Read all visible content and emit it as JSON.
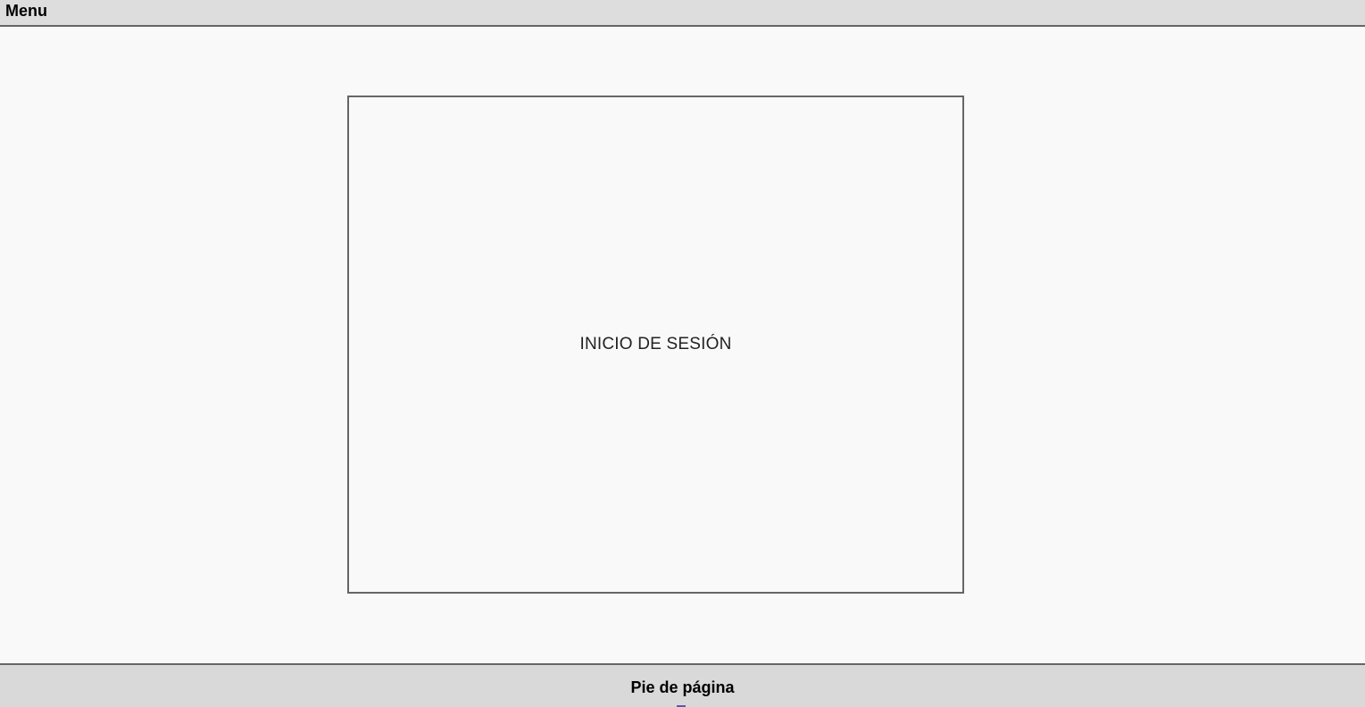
{
  "menu": {
    "label": "Menu"
  },
  "main": {
    "login_box_label": "INICIO DE SESIÓN"
  },
  "footer": {
    "label": "Pie de página"
  },
  "colors": {
    "menu_bg": "#dddddd",
    "page_bg": "#f9f9f9",
    "border": "#666666",
    "footer_bg": "#d9d9d9"
  }
}
